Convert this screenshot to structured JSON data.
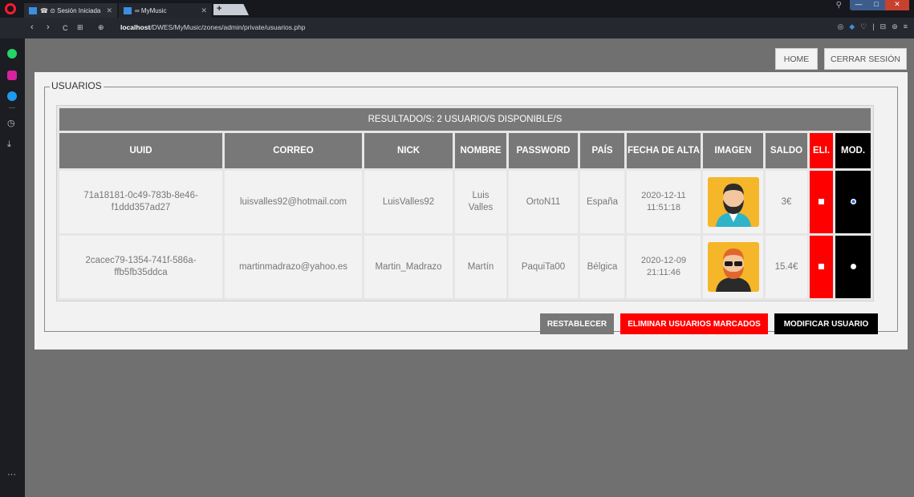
{
  "browser": {
    "tabs": [
      {
        "label": "☎ ⊙ Sesión Iniciada",
        "close": "✕"
      },
      {
        "label": "∞ MyMusic",
        "close": "✕"
      }
    ],
    "new_tab": "+",
    "url_host": "localhost",
    "url_path": "/DWES/MyMusic/zones/admin/private/usuarios.php",
    "nav": {
      "back": "‹",
      "forward": "›",
      "reload": "C",
      "speed_dial": "⊞",
      "site_info": "⊕"
    },
    "window": {
      "minimize": "—",
      "maximize": "□",
      "close": "✕"
    },
    "right_tools": [
      "◎",
      "◆",
      "♡",
      "|",
      "⊟",
      "⊚",
      "≡"
    ],
    "sidebar_more": "···"
  },
  "header": {
    "home_label": "HOME",
    "logout_label": "CERRAR SESIÓN"
  },
  "section": {
    "legend": "USUARIOS"
  },
  "table": {
    "result_text": "RESULTADO/S: 2 USUARIO/S DISPONIBLE/S",
    "columns": [
      "UUID",
      "CORREO",
      "NICK",
      "NOMBRE",
      "PASSWORD",
      "PAÍS",
      "FECHA DE ALTA",
      "IMAGEN",
      "SALDO",
      "ELI.",
      "MOD."
    ],
    "rows": [
      {
        "uuid": "71a18181-0c49-783b-8e46-f1ddd357ad27",
        "correo": "luisvalles92@hotmail.com",
        "nick": "LuisValles92",
        "nombre": "Luis Valles",
        "password": "OrtoN11",
        "pais": "España",
        "fecha": "2020-12-11 11:51:18",
        "saldo": "3€",
        "avatar_color": "#f5b629",
        "mod_selected": true
      },
      {
        "uuid": "2cacec79-1354-741f-586a-ffb5fb35ddca",
        "correo": "martinmadrazo@yahoo.es",
        "nick": "Martin_Madrazo",
        "nombre": "Martín",
        "password": "PaquiTa00",
        "pais": "Bélgica",
        "fecha": "2020-12-09 21:11:46",
        "saldo": "15.4€",
        "avatar_color": "#f5b629",
        "mod_selected": false
      }
    ]
  },
  "actions": {
    "reset_label": "RESTABLECER",
    "delete_label": "ELIMINAR USUARIOS MARCADOS",
    "modify_label": "MODIFICAR USUARIO"
  },
  "colors": {
    "danger": "#ff0000",
    "dark": "#000000",
    "header_gray": "#787878",
    "avatar_bg": "#f5b629"
  }
}
